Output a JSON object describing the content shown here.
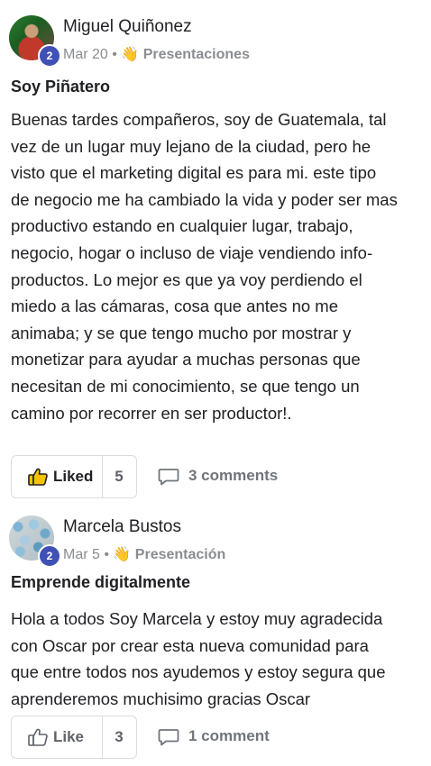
{
  "posts": [
    {
      "author": "Miguel Quiñonez",
      "level": "2",
      "date": "Mar 20",
      "separator": "•",
      "category_icon": "👋",
      "category": "Presentaciones",
      "title": "Soy Piñatero",
      "body_lines": [
        "Buenas tardes compañeros, soy de Guatemala, tal",
        "vez de un lugar muy lejano de la ciudad, pero he",
        "visto que el marketing digital es para mi. este tipo",
        "de negocio me ha cambiado la vida y poder ser mas",
        "productivo estando en cualquier lugar, trabajo,",
        "negocio, hogar o incluso de viaje vendiendo info-",
        "productos. Lo mejor es que ya voy perdiendo el",
        "miedo a las cámaras, cosa que antes no me",
        "animaba; y se que tengo mucho por mostrar y",
        "monetizar para ayudar a muchas personas que",
        "necesitan de mi conocimiento, se que tengo un",
        "camino por recorrer en ser productor!."
      ],
      "like_label": "Liked",
      "liked": true,
      "like_count": "5",
      "comments_label": "3 comments"
    },
    {
      "author": "Marcela Bustos",
      "level": "2",
      "date": "Mar 5",
      "separator": "•",
      "category_icon": "👋",
      "category": "Presentación",
      "title": "Emprende digitalmente",
      "body_lines": [
        "Hola a todos Soy Marcela y estoy muy agradecida",
        "con Oscar por crear esta nueva comunidad para",
        "que entre todos nos ayudemos y estoy segura que",
        "aprenderemos muchisimo gracias Oscar"
      ],
      "like_label": "Like",
      "liked": false,
      "like_count": "3",
      "comments_label": "1 comment"
    }
  ]
}
